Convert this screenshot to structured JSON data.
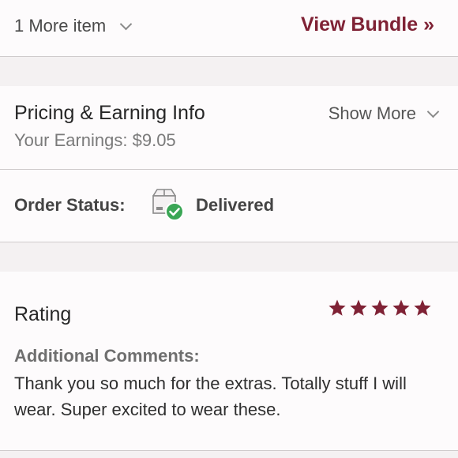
{
  "bundle_row": {
    "more_items_label": "1 More item",
    "view_bundle_label": "View Bundle »"
  },
  "pricing": {
    "title": "Pricing & Earning Info",
    "earnings_text": "Your Earnings: $9.05",
    "show_more_label": "Show More"
  },
  "order_status": {
    "label": "Order Status:",
    "value": "Delivered",
    "icon": "delivered-box-check-icon",
    "check_color": "#3aa655"
  },
  "rating": {
    "title": "Rating",
    "stars": 5,
    "max_stars": 5,
    "star_color": "#7f2235",
    "comments_label": "Additional Comments:",
    "comments_text": "Thank you so much for the extras. Totally stuff I will wear. Super excited to wear these."
  },
  "colors": {
    "accent": "#7f2235",
    "background": "#fdfbfc",
    "divider": "#cfcbcc"
  }
}
